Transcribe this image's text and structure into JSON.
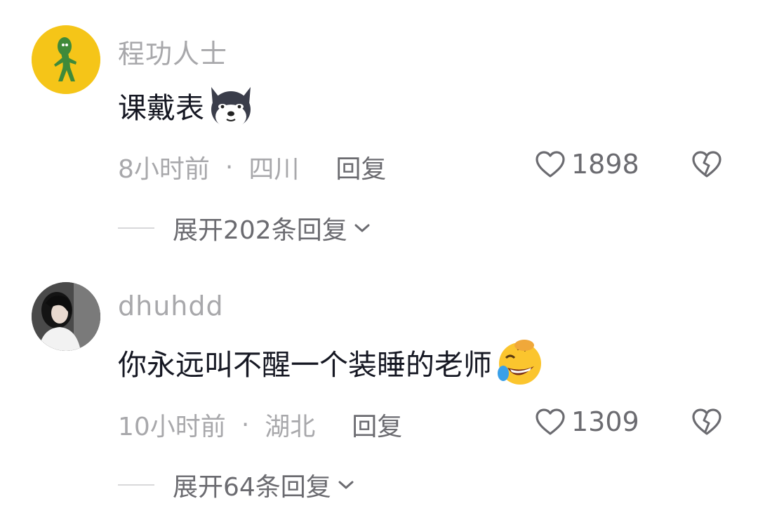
{
  "comments": [
    {
      "username": "程功人士",
      "text": "课戴表",
      "emoji_icon": "husky-dog-emoji-icon",
      "time": "8小时前",
      "separator": "·",
      "location": "四川",
      "reply_label": "回复",
      "likes": "1898",
      "expand_label": "展开202条回复",
      "avatar_bg": "#f5c518"
    },
    {
      "username": "dhuhdd",
      "text": "你永远叫不醒一个装睡的老师",
      "emoji_icon": "rofl-emoji-icon",
      "time": "10小时前",
      "separator": "·",
      "location": "湖北",
      "reply_label": "回复",
      "likes": "1309",
      "expand_label": "展开64条回复",
      "avatar_bg": "#5a5a5a"
    }
  ],
  "colors": {
    "text_primary": "#161823",
    "text_secondary": "#a8a8ab",
    "text_action": "#6b6b70",
    "accent_yellow": "#f5c518"
  }
}
